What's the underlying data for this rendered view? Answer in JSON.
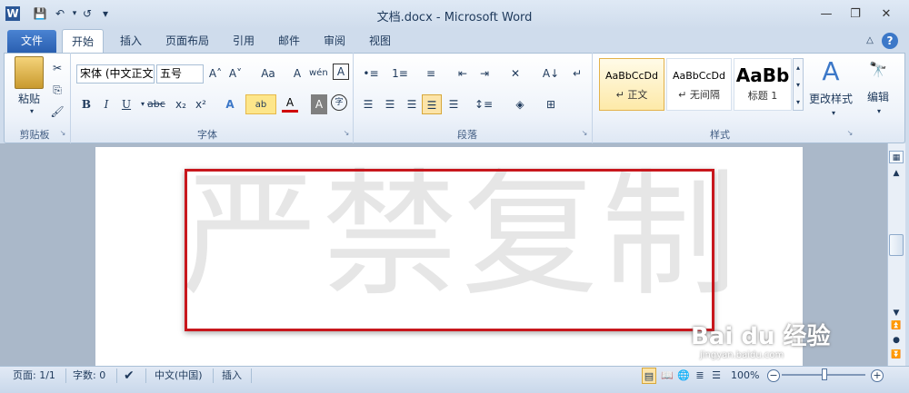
{
  "titlebar": {
    "title": "文档.docx - Microsoft Word",
    "word_icon": "W",
    "save_icon": "save-icon",
    "undo": "↶",
    "redo": "↺",
    "qat_more": "▾",
    "minimize": "—",
    "restore": "❐",
    "close": "✕"
  },
  "tabs": {
    "file": "文件",
    "home": "开始",
    "insert": "插入",
    "layout": "页面布局",
    "references": "引用",
    "mailings": "邮件",
    "review": "审阅",
    "view": "视图"
  },
  "ribbon_right": {
    "help": "?",
    "collapse": "△"
  },
  "clipboard": {
    "paste": "粘贴",
    "cut": "✂",
    "copy": "⎘",
    "format_painter": "🖌",
    "label": "剪贴板"
  },
  "font": {
    "font_name": "宋体 (中文正文",
    "font_size": "五号",
    "grow": "A˄",
    "shrink": "A˅",
    "case": "Aa",
    "clear": "A",
    "phonetic": "wén",
    "border_char": "A",
    "bold": "B",
    "italic": "I",
    "underline": "U",
    "strike": "abc",
    "sub": "x₂",
    "sup": "x²",
    "effects": "A",
    "highlight": "ab",
    "color": "A",
    "shade": "A",
    "enclose": "字",
    "label": "字体"
  },
  "paragraph": {
    "label": "段落",
    "bullets": "•≡",
    "numbering": "1≡",
    "multilevel": "≡",
    "dec_indent": "⇤",
    "inc_indent": "⇥",
    "cn_layout": "✕",
    "sort": "A↓",
    "pilcrow": "↵"
  },
  "styles": {
    "label": "样式",
    "items": [
      {
        "sample": "AaBbCcDd",
        "name": "↵ 正文"
      },
      {
        "sample": "AaBbCcDd",
        "name": "↵ 无间隔"
      },
      {
        "sample": "AaBb",
        "name": "标题 1"
      }
    ],
    "change": "更改样式"
  },
  "editing": {
    "label": "编辑"
  },
  "document": {
    "watermark": "严禁复制"
  },
  "statusbar": {
    "page": "页面: 1/1",
    "words": "字数: 0",
    "language": "中文(中国)",
    "mode": "插入",
    "zoom": "100%",
    "zoom_out": "−",
    "zoom_in": "+"
  },
  "overlay": {
    "logo": "Bai du 经验",
    "url": "jingyan.baidu.com"
  },
  "colors": {
    "accent": "#2a5fb0",
    "highlight": "#c8171d"
  }
}
